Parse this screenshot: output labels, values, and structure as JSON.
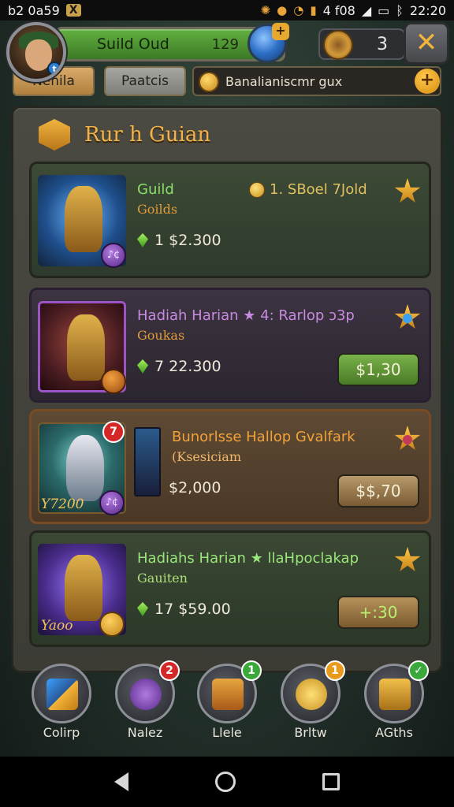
{
  "status_bar": {
    "left_text": "b2 0a59",
    "x_label": "X",
    "right_text": "4 f08",
    "time": "22:20"
  },
  "header": {
    "avatar_badge": "t",
    "guild_name": "Suild Oud",
    "guild_level": "129",
    "currency_count": "3",
    "close_label": "✕"
  },
  "tabs": [
    {
      "label": "Nenila"
    },
    {
      "label": "Paatcis"
    }
  ],
  "search": {
    "value": "Banalianiscmr gux",
    "add_label": "+"
  },
  "panel": {
    "title": "Rur h Guian"
  },
  "cards": [
    {
      "title": "Guild",
      "subtitle": "Goilds",
      "reward": "1. SBoel 7Jold",
      "price": "1 $2.300",
      "badge": "♪¢",
      "button": ""
    },
    {
      "title": "Hadiah Harian  ★ 4: Rarlop ɔ3p",
      "subtitle": "Goukas",
      "price": "7 22.300",
      "badge": "",
      "button": "$1,30"
    },
    {
      "title": "Bunorlsse Hallop Gvalfark",
      "subtitle": "(Ksesiciam",
      "price": "$2,000",
      "badge": "♪¢",
      "red_badge": "7",
      "cost_tag": "Y7200",
      "button": "$$,70"
    },
    {
      "title": "Hadiahs Harian  ★ llaHpoclakap",
      "subtitle": "Gauiten",
      "price": "17 $59.00",
      "badge": "",
      "cost_tag": "Yaoo",
      "button": "+:30"
    }
  ],
  "bottom_nav": [
    {
      "label": "Colirp",
      "badge": "",
      "icon": "crystal-icon"
    },
    {
      "label": "Nalez",
      "badge": "2",
      "icon": "gauntlet-icon"
    },
    {
      "label": "Llele",
      "badge": "1",
      "icon": "chest-icon"
    },
    {
      "label": "Brltw",
      "badge": "1",
      "icon": "coins-icon"
    },
    {
      "label": "AGths",
      "badge": "✓",
      "icon": "treasure-icon"
    }
  ],
  "colors": {
    "accent_gold": "#f1b248",
    "guild_bar_green": "#4f962f",
    "buy_green": "#62963a"
  }
}
